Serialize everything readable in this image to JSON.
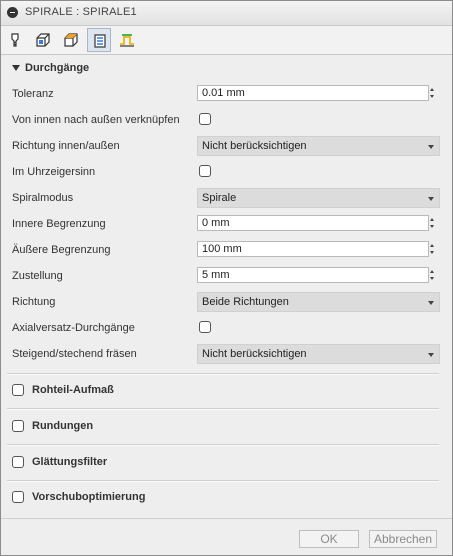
{
  "window": {
    "title": "SPIRALE : SPIRALE1",
    "title_icon": "minus-circle-icon"
  },
  "tabs": [
    {
      "icon": "tool-icon"
    },
    {
      "icon": "geometry-icon"
    },
    {
      "icon": "heights-icon"
    },
    {
      "icon": "passes-icon",
      "active": true
    },
    {
      "icon": "linking-icon"
    }
  ],
  "section": {
    "title": "Durchgänge",
    "rows": {
      "toleranz": {
        "label": "Toleranz",
        "value": "0.01 mm"
      },
      "verknuepfen": {
        "label": "Von innen nach außen verknüpfen",
        "checked": false
      },
      "richtung_io": {
        "label": "Richtung innen/außen",
        "value": "Nicht berücksichtigen"
      },
      "uhrzeigersinn": {
        "label": "Im Uhrzeigersinn",
        "checked": false
      },
      "spiralmodus": {
        "label": "Spiralmodus",
        "value": "Spirale"
      },
      "innere": {
        "label": "Innere Begrenzung",
        "value": "0 mm"
      },
      "aeussere": {
        "label": "Äußere Begrenzung",
        "value": "100 mm"
      },
      "zustellung": {
        "label": "Zustellung",
        "value": "5 mm"
      },
      "richtung": {
        "label": "Richtung",
        "value": "Beide Richtungen"
      },
      "axialversatz": {
        "label": "Axialversatz-Durchgänge",
        "checked": false
      },
      "steigend": {
        "label": "Steigend/stechend fräsen",
        "value": "Nicht berücksichtigen"
      }
    }
  },
  "collapsed_sections": {
    "rohteil": {
      "label": "Rohteil-Aufmaß",
      "checked": false
    },
    "rundungen": {
      "label": "Rundungen",
      "checked": false
    },
    "glaettung": {
      "label": "Glättungsfilter",
      "checked": false
    },
    "vorschub": {
      "label": "Vorschuboptimierung",
      "checked": false
    }
  },
  "footer": {
    "ok_label": "OK",
    "cancel_label": "Abbrechen"
  }
}
